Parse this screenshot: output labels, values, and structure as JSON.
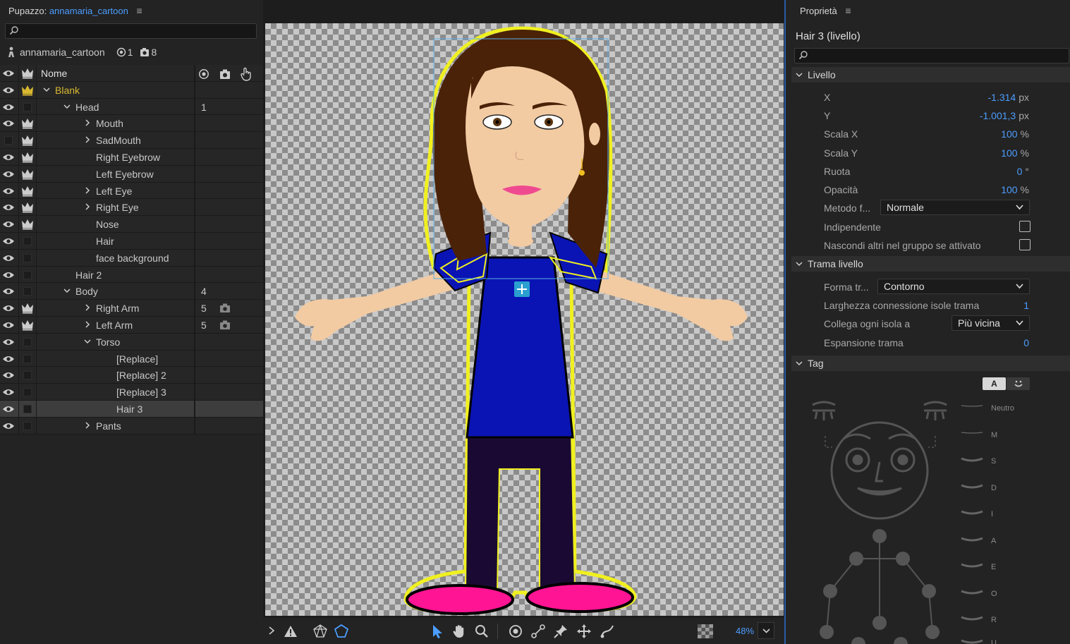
{
  "left_panel": {
    "title_prefix": "Pupazzo:",
    "title_name": "annamaria_cartoon",
    "puppet_name": "annamaria_cartoon",
    "handle_count": "1",
    "camera_count": "8",
    "header": {
      "name": "Nome"
    },
    "layers": [
      {
        "name": "Blank",
        "indent": 0,
        "chevron": "down",
        "crown": "gold",
        "count": "",
        "cam": false
      },
      {
        "name": "Head",
        "indent": 1,
        "chevron": "down",
        "crown": "none",
        "count": "1",
        "cam": false
      },
      {
        "name": "Mouth",
        "indent": 2,
        "chevron": "right",
        "crown": "white",
        "count": "",
        "cam": false
      },
      {
        "name": "SadMouth",
        "indent": 2,
        "chevron": "right",
        "crown": "white",
        "count": "",
        "cam": false,
        "eye_off": true
      },
      {
        "name": "Right Eyebrow",
        "indent": 2,
        "chevron": "",
        "crown": "white",
        "count": "",
        "cam": false
      },
      {
        "name": "Left Eyebrow",
        "indent": 2,
        "chevron": "",
        "crown": "white",
        "count": "",
        "cam": false
      },
      {
        "name": "Left Eye",
        "indent": 2,
        "chevron": "right",
        "crown": "white",
        "count": "",
        "cam": false
      },
      {
        "name": "Right Eye",
        "indent": 2,
        "chevron": "right",
        "crown": "white",
        "count": "",
        "cam": false
      },
      {
        "name": "Nose",
        "indent": 2,
        "chevron": "",
        "crown": "white",
        "count": "",
        "cam": false
      },
      {
        "name": "Hair",
        "indent": 2,
        "chevron": "",
        "crown": "none",
        "count": "",
        "cam": false
      },
      {
        "name": "face background",
        "indent": 2,
        "chevron": "",
        "crown": "none",
        "count": "",
        "cam": false
      },
      {
        "name": "Hair 2",
        "indent": 1,
        "chevron": "",
        "crown": "none",
        "count": "",
        "cam": false
      },
      {
        "name": "Body",
        "indent": 1,
        "chevron": "down",
        "crown": "none",
        "count": "4",
        "cam": false
      },
      {
        "name": "Right Arm",
        "indent": 2,
        "chevron": "right",
        "crown": "white",
        "count": "5",
        "cam": true
      },
      {
        "name": "Left Arm",
        "indent": 2,
        "chevron": "right",
        "crown": "white",
        "count": "5",
        "cam": true
      },
      {
        "name": "Torso",
        "indent": 2,
        "chevron": "down",
        "crown": "none",
        "count": "",
        "cam": false
      },
      {
        "name": "[Replace]",
        "indent": 3,
        "chevron": "",
        "crown": "none",
        "count": "",
        "cam": false
      },
      {
        "name": "[Replace] 2",
        "indent": 3,
        "chevron": "",
        "crown": "none",
        "count": "",
        "cam": false
      },
      {
        "name": "[Replace] 3",
        "indent": 3,
        "chevron": "",
        "crown": "none",
        "count": "",
        "cam": false
      },
      {
        "name": "Hair 3",
        "indent": 3,
        "chevron": "",
        "crown": "none",
        "count": "",
        "cam": false,
        "selected": true
      },
      {
        "name": "Pants",
        "indent": 2,
        "chevron": "right",
        "crown": "none",
        "count": "",
        "cam": false
      }
    ]
  },
  "center": {
    "zoom": "48%"
  },
  "right_panel": {
    "title": "Proprietà",
    "selection_title": "Hair 3 (livello)",
    "sections": {
      "livello": "Livello",
      "trama": "Trama livello",
      "tag": "Tag"
    },
    "livello": {
      "x_label": "X",
      "x_value": "-1.314",
      "x_unit": "px",
      "y_label": "Y",
      "y_value": "-1.001,3",
      "y_unit": "px",
      "scalax_label": "Scala X",
      "scalax_value": "100",
      "scalax_unit": "%",
      "scalay_label": "Scala Y",
      "scalay_value": "100",
      "scalay_unit": "%",
      "ruota_label": "Ruota",
      "ruota_value": "0",
      "ruota_unit": "°",
      "opacita_label": "Opacità",
      "opacita_value": "100",
      "opacita_unit": "%",
      "metodo_label": "Metodo f...",
      "metodo_value": "Normale",
      "indip_label": "Indipendente",
      "nascondi_label": "Nascondi altri nel gruppo se attivato"
    },
    "trama": {
      "forma_label": "Forma tr...",
      "forma_value": "Contorno",
      "larghezza_label": "Larghezza connessione isole trama",
      "larghezza_value": "1",
      "collega_label": "Collega ogni isola a",
      "collega_value": "Più vicina",
      "espansione_label": "Espansione trama",
      "espansione_value": "0"
    },
    "tag": {
      "btn_text": "A",
      "visemes": [
        "Neutro",
        "M",
        "S",
        "D",
        "I",
        "A",
        "E",
        "O",
        "R",
        "U"
      ]
    }
  },
  "colors": {
    "accent": "#4c9dff",
    "crown_gold": "#d8b830",
    "shirt": "#0a14b4",
    "pants": "#1a0a33",
    "shoes": "#ff1493",
    "skin": "#f2cba3",
    "hair": "#4a2208",
    "outline": "#f0f020"
  }
}
